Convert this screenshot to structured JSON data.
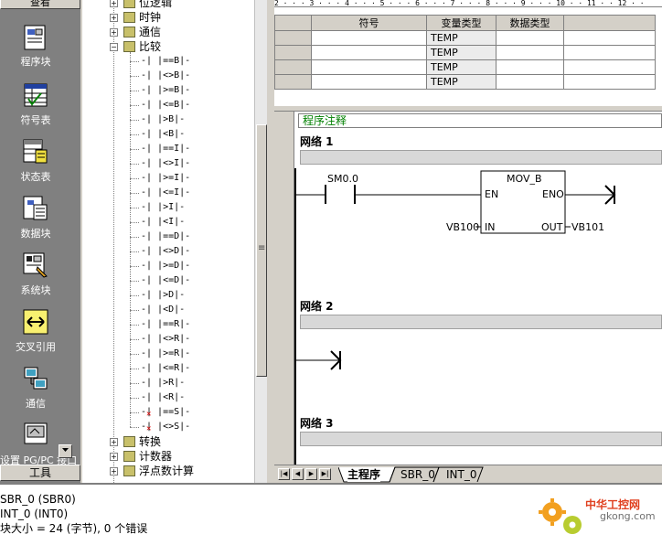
{
  "nav": {
    "header": "查看",
    "items": [
      {
        "label": "程序块",
        "icon": "program-block-icon"
      },
      {
        "label": "符号表",
        "icon": "symbol-table-icon"
      },
      {
        "label": "状态表",
        "icon": "status-table-icon"
      },
      {
        "label": "数据块",
        "icon": "data-block-icon"
      },
      {
        "label": "系统块",
        "icon": "system-block-icon"
      },
      {
        "label": "交叉引用",
        "icon": "cross-reference-icon"
      },
      {
        "label": "通信",
        "icon": "communication-icon"
      },
      {
        "label": "设置 PG/PC 接口",
        "icon": "pgpc-interface-icon"
      }
    ],
    "footer": "工具"
  },
  "tree": {
    "top_items": [
      {
        "label": "位逻辑",
        "expanded": false
      },
      {
        "label": "时钟",
        "expanded": false
      },
      {
        "label": "通信",
        "expanded": false
      },
      {
        "label": "比较",
        "expanded": true
      }
    ],
    "compare_items": [
      "-| |==B|-",
      "-| |<>B|-",
      "-| |>=B|-",
      "-| |<=B|-",
      "-| |>B|-",
      "-| |<B|-",
      "-| |==I|-",
      "-| |<>I|-",
      "-| |>=I|-",
      "-| |<=I|-",
      "-| |>I|-",
      "-| |<I|-",
      "-| |==D|-",
      "-| |<>D|-",
      "-| |>=D|-",
      "-| |<=D|-",
      "-| |>D|-",
      "-| |<D|-",
      "-| |==R|-",
      "-| |<>R|-",
      "-| |>=R|-",
      "-| |<=R|-",
      "-| |>R|-",
      "-| |<R|-",
      "-| |==S|-",
      "-| |<>S|-"
    ],
    "bottom_items": [
      {
        "label": "转换"
      },
      {
        "label": "计数器"
      },
      {
        "label": "浮点数计算"
      }
    ]
  },
  "ruler": "2 · · · 3 · · · 4 · · · 5 · · · 6 · · · 7 · · · 8 · · · 9 · · · 10 · · 11 · · 12 · ·",
  "var_table": {
    "headers": [
      "",
      "符号",
      "变量类型",
      "数据类型",
      ""
    ],
    "rows": [
      {
        "var_type": "TEMP"
      },
      {
        "var_type": "TEMP"
      },
      {
        "var_type": "TEMP"
      },
      {
        "var_type": "TEMP"
      }
    ]
  },
  "editor": {
    "program_comment": "程序注释",
    "networks": [
      {
        "title": "网络 1"
      },
      {
        "title": "网络 2"
      },
      {
        "title": "网络 3"
      }
    ],
    "network1": {
      "contact": "SM0.0",
      "box_name": "MOV_B",
      "en": "EN",
      "eno": "ENO",
      "in_pin": "IN",
      "out_pin": "OUT",
      "in_operand": "VB100",
      "out_operand": "VB101"
    }
  },
  "tabs": {
    "items": [
      "主程序",
      "SBR_0",
      "INT_0"
    ],
    "active": "主程序"
  },
  "output": {
    "lines": [
      "SBR_0 (SBR0)",
      "INT_0 (INT0)",
      "块大小 = 24 (字节), 0 个错误"
    ]
  },
  "watermark": {
    "line1": "中华工控网",
    "line2": "gkong.com"
  }
}
